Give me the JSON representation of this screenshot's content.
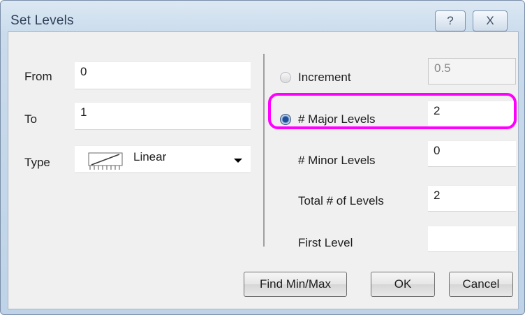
{
  "window": {
    "title": "Set Levels",
    "help_label": "?",
    "close_label": "X"
  },
  "left": {
    "from_label": "From",
    "from_value": "0",
    "to_label": "To",
    "to_value": "1",
    "type_label": "Type",
    "type_value": "Linear",
    "type_icon": "linear-scale-icon"
  },
  "right": {
    "increment_label": "Increment",
    "increment_value": "0.5",
    "increment_selected": false,
    "major_label": "# Major Levels",
    "major_value": "2",
    "major_selected": true,
    "minor_label": "# Minor Levels",
    "minor_value": "0",
    "total_label": "Total # of Levels",
    "total_value": "2",
    "first_label": "First Level",
    "first_value": ""
  },
  "buttons": {
    "find_label": "Find Min/Max",
    "ok_label": "OK",
    "cancel_label": "Cancel"
  },
  "colors": {
    "highlight": "#ff00ff",
    "titlebar": "#c9dbec"
  }
}
